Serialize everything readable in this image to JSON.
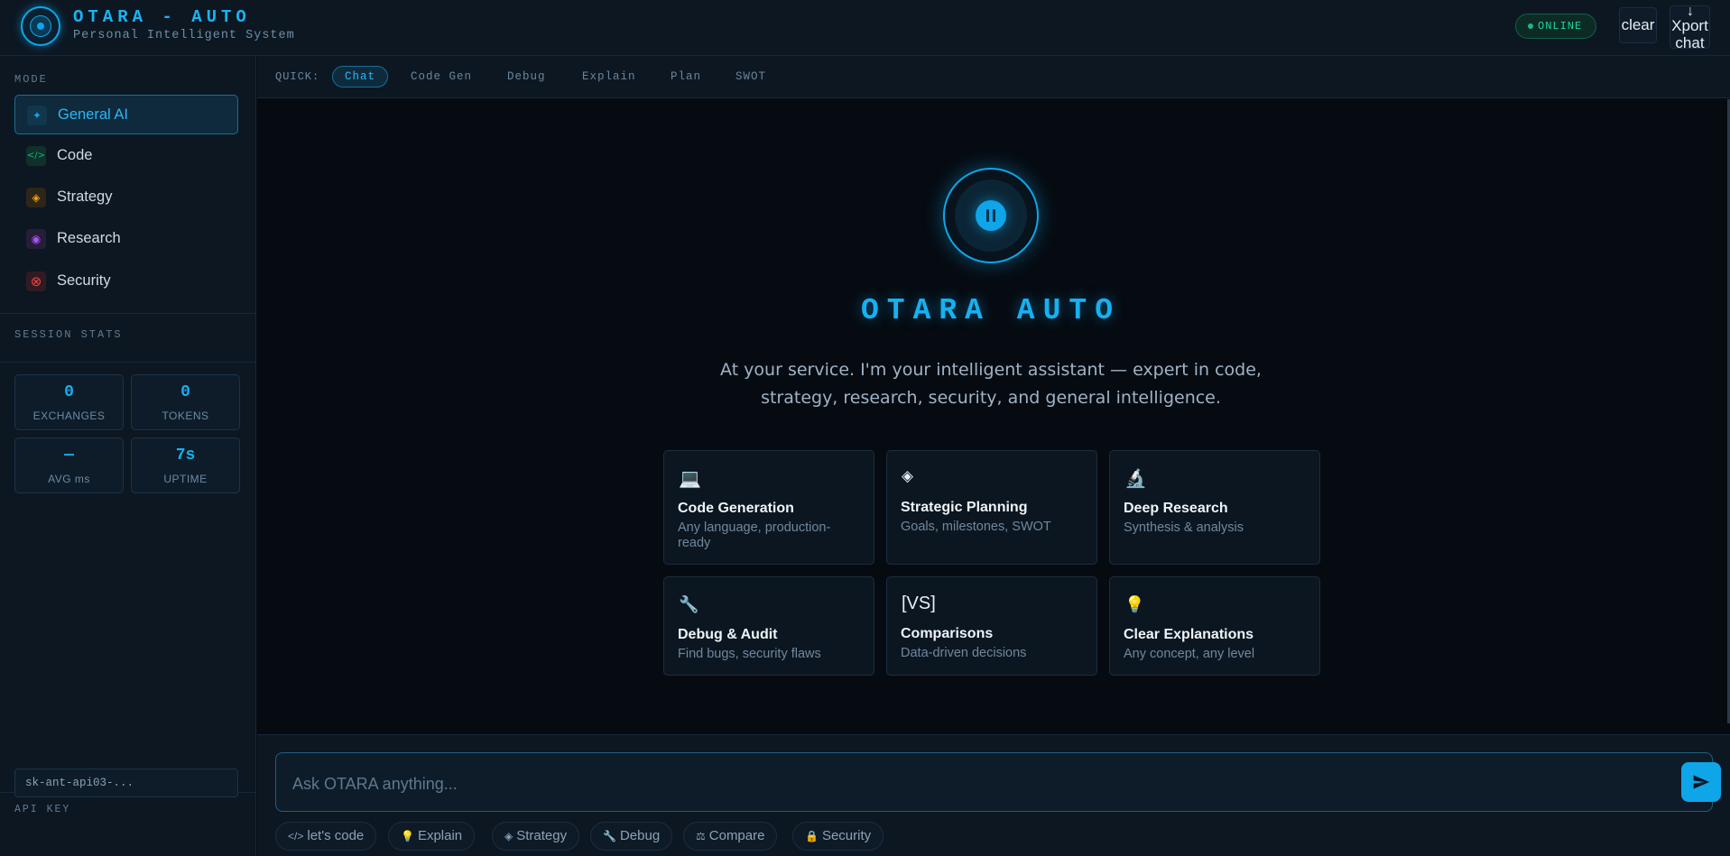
{
  "header": {
    "brand": "OTARA - AUTO",
    "subtitle": "Personal Intelligent System",
    "status": "ONLINE",
    "clear_label": "clear",
    "export_arrow": "↓",
    "export_label": "Xport chat"
  },
  "sidebar": {
    "mode_label": "MODE",
    "modes": [
      {
        "label": "General AI",
        "icon": "sparkle-icon",
        "glyph": "✦",
        "color": "#0ea5e9"
      },
      {
        "label": "Code",
        "icon": "code-icon",
        "glyph": "</>",
        "color": "#10b981"
      },
      {
        "label": "Strategy",
        "icon": "diamond-icon",
        "glyph": "◈",
        "color": "#f59e0b"
      },
      {
        "label": "Research",
        "icon": "target-icon",
        "glyph": "◉",
        "color": "#a855f7"
      },
      {
        "label": "Security",
        "icon": "shield-icon",
        "glyph": "⊗",
        "color": "#ef4444"
      }
    ],
    "stats_label": "SESSION STATS",
    "stats": [
      {
        "value": "0",
        "label": "EXCHANGES"
      },
      {
        "value": "0",
        "label": "TOKENS"
      },
      {
        "value": "—",
        "label": "AVG ms"
      },
      {
        "value": "7s",
        "label": "UPTIME"
      }
    ],
    "api_label": "API KEY",
    "api_value": "sk-ant-api03-..."
  },
  "quickbar": {
    "label": "QUICK:",
    "tabs": [
      "Chat",
      "Code Gen",
      "Debug",
      "Explain",
      "Plan",
      "SWOT"
    ]
  },
  "main": {
    "title": "OTARA AUTO",
    "description": "At your service. I'm your intelligent assistant — expert in code, strategy, research, security, and general intelligence.",
    "cards": [
      {
        "icon": "laptop-icon",
        "glyph": "💻",
        "title": "Code Generation",
        "desc": "Any language, production-ready"
      },
      {
        "icon": "diamond-icon",
        "glyph": "◈",
        "title": "Strategic Planning",
        "desc": "Goals, milestones, SWOT"
      },
      {
        "icon": "microscope-icon",
        "glyph": "🔬",
        "title": "Deep Research",
        "desc": "Synthesis & analysis"
      },
      {
        "icon": "wrench-icon",
        "glyph": "🔧",
        "title": "Debug & Audit",
        "desc": "Find bugs, security flaws"
      },
      {
        "icon": "vs-icon",
        "glyph": "[VS]",
        "title": "Comparisons",
        "desc": "Data-driven decisions"
      },
      {
        "icon": "lightbulb-icon",
        "glyph": "💡",
        "title": "Clear Explanations",
        "desc": "Any concept, any level"
      }
    ]
  },
  "input": {
    "placeholder": "Ask OTARA anything...",
    "chips": [
      {
        "icon": "code-icon",
        "glyph": "</>",
        "label": "let's code"
      },
      {
        "icon": "lightbulb-icon",
        "glyph": "💡",
        "label": "Explain"
      },
      {
        "icon": "diamond-icon",
        "glyph": "◈",
        "label": "Strategy"
      },
      {
        "icon": "wrench-icon",
        "glyph": "🔧",
        "label": "Debug"
      },
      {
        "icon": "scales-icon",
        "glyph": "⚖",
        "label": "Compare"
      },
      {
        "icon": "lock-icon",
        "glyph": "🔒",
        "label": "Security"
      }
    ]
  }
}
